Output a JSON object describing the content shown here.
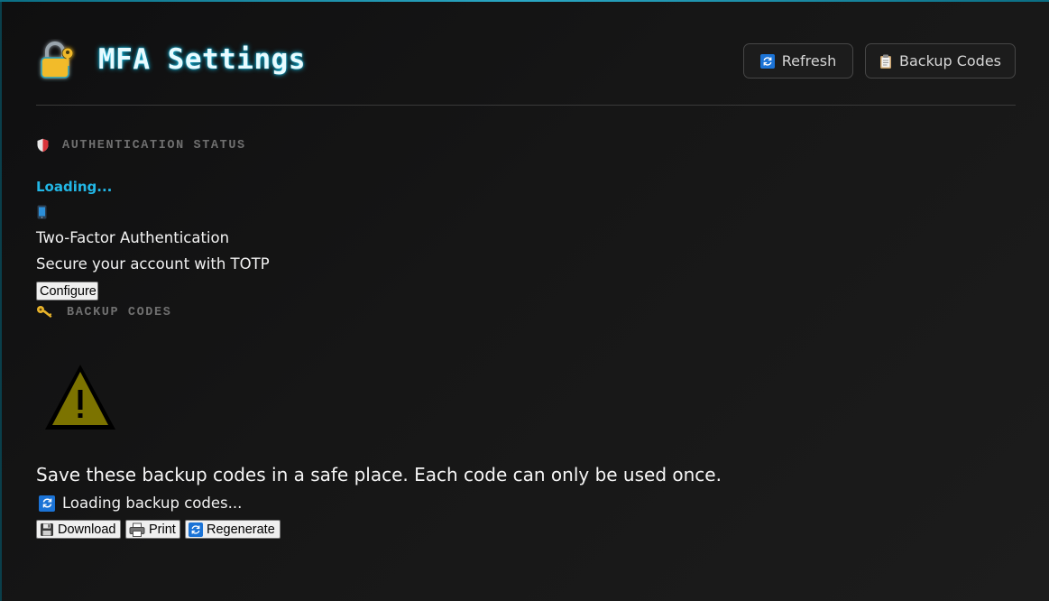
{
  "header": {
    "title": "MFA Settings",
    "logo_icon": "locked-with-key-icon",
    "refresh_label": "Refresh",
    "backup_codes_label": "Backup Codes"
  },
  "auth_section": {
    "heading": "AUTHENTICATION STATUS",
    "icon": "shield-icon",
    "loading_text": "Loading...",
    "method_icon": "mobile-phone-icon",
    "method_title": "Two-Factor Authentication",
    "method_subtitle": "Secure your account with TOTP",
    "configure_label": "Configure"
  },
  "backup_section": {
    "heading": "BACKUP CODES",
    "icon": "key-icon",
    "warning_icon": "warning-icon",
    "warning_text": "Save these backup codes in a safe place. Each code can only be used once.",
    "loading_text": "Loading backup codes...",
    "download_label": "Download",
    "print_label": "Print",
    "regenerate_label": "Regenerate"
  },
  "colors": {
    "accent": "#22b7e6",
    "title_glow": "#15b9df",
    "background": "#161616",
    "warning": "#7c7300"
  }
}
